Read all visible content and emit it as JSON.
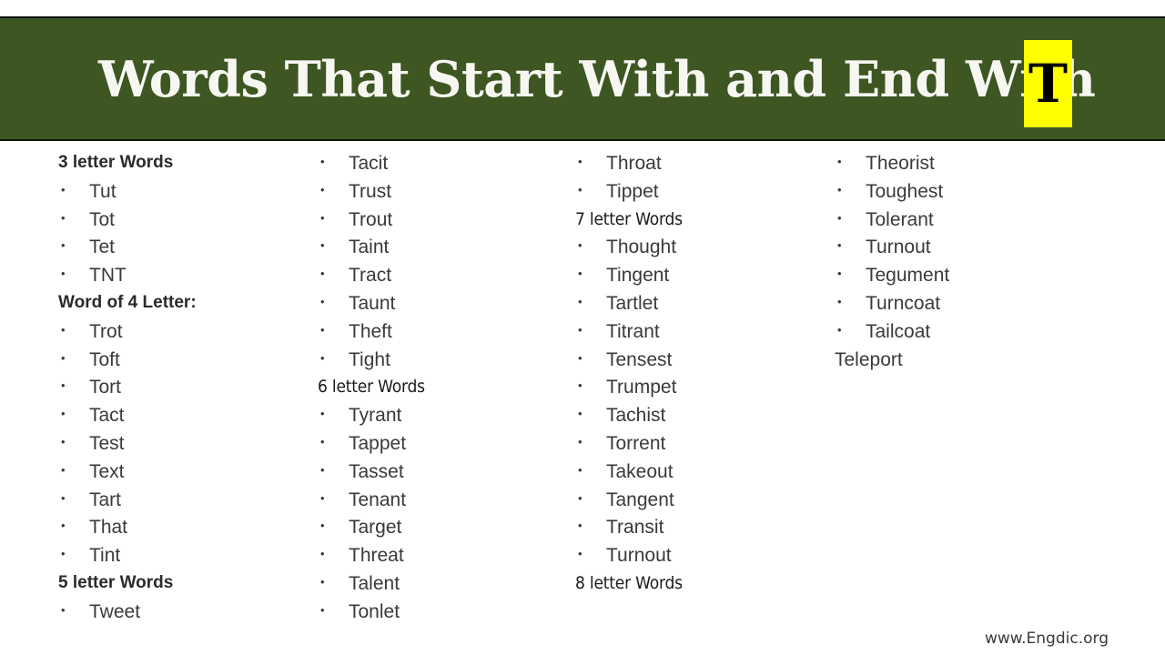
{
  "header": {
    "title": "Words That Start With and End With",
    "letter_badge": "T",
    "background_color": "#3d5622",
    "badge_color": "#ffff00",
    "title_color": "#f7f7f2"
  },
  "columns": [
    {
      "entries": [
        {
          "type": "heading",
          "style": "bold",
          "label": "3 letter Words"
        },
        {
          "type": "word",
          "bullet": "•",
          "label": "Tut"
        },
        {
          "type": "word",
          "bullet": "•",
          "label": "Tot"
        },
        {
          "type": "word",
          "bullet": "•",
          "label": "Tet"
        },
        {
          "type": "word",
          "bullet": "•",
          "label": "TNT"
        },
        {
          "type": "heading",
          "style": "bold",
          "label": "Word of 4 Letter:"
        },
        {
          "type": "word",
          "bullet": "•",
          "label": "Trot"
        },
        {
          "type": "word",
          "bullet": "•",
          "label": "Toft"
        },
        {
          "type": "word",
          "bullet": "•",
          "label": "Tort"
        },
        {
          "type": "word",
          "bullet": "•",
          "label": "Tact"
        },
        {
          "type": "word",
          "bullet": "•",
          "label": "Test"
        },
        {
          "type": "word",
          "bullet": "•",
          "label": "Text"
        },
        {
          "type": "word",
          "bullet": "•",
          "label": "Tart"
        },
        {
          "type": "word",
          "bullet": "•",
          "label": "That"
        },
        {
          "type": "word",
          "bullet": "•",
          "label": "Tint"
        },
        {
          "type": "heading",
          "style": "bold",
          "label": "5 letter Words"
        },
        {
          "type": "word",
          "bullet": "•",
          "label": "Tweet"
        }
      ]
    },
    {
      "entries": [
        {
          "type": "word",
          "bullet": "•",
          "label": "Tacit"
        },
        {
          "type": "word",
          "bullet": "•",
          "label": "Trust"
        },
        {
          "type": "word",
          "bullet": "•",
          "label": "Trout"
        },
        {
          "type": "word",
          "bullet": "•",
          "label": "Taint"
        },
        {
          "type": "word",
          "bullet": "•",
          "label": "Tract"
        },
        {
          "type": "word",
          "bullet": "•",
          "label": "Taunt"
        },
        {
          "type": "word",
          "bullet": "•",
          "label": "Theft"
        },
        {
          "type": "word",
          "bullet": "•",
          "label": "Tight"
        },
        {
          "type": "heading",
          "style": "narrow",
          "label": "6 letter Words"
        },
        {
          "type": "word",
          "bullet": "•",
          "label": "Tyrant"
        },
        {
          "type": "word",
          "bullet": "•",
          "label": "Tappet"
        },
        {
          "type": "word",
          "bullet": "•",
          "label": "Tasset"
        },
        {
          "type": "word",
          "bullet": "•",
          "label": "Tenant"
        },
        {
          "type": "word",
          "bullet": "•",
          "label": "Target"
        },
        {
          "type": "word",
          "bullet": "•",
          "label": "Threat"
        },
        {
          "type": "word",
          "bullet": "•",
          "label": "Talent"
        },
        {
          "type": "word",
          "bullet": "•",
          "label": "Tonlet"
        }
      ]
    },
    {
      "entries": [
        {
          "type": "word",
          "bullet": "•",
          "label": "Throat"
        },
        {
          "type": "word",
          "bullet": "•",
          "label": "Tippet"
        },
        {
          "type": "heading",
          "style": "narrow",
          "label": "7 letter Words"
        },
        {
          "type": "word",
          "bullet": "•",
          "label": "Thought"
        },
        {
          "type": "word",
          "bullet": "•",
          "label": "Tingent"
        },
        {
          "type": "word",
          "bullet": "•",
          "label": "Tartlet"
        },
        {
          "type": "word",
          "bullet": "•",
          "label": "Titrant"
        },
        {
          "type": "word",
          "bullet": "•",
          "label": "Tensest"
        },
        {
          "type": "word",
          "bullet": "•",
          "label": "Trumpet"
        },
        {
          "type": "word",
          "bullet": "•",
          "label": "Tachist"
        },
        {
          "type": "word",
          "bullet": "•",
          "label": "Torrent"
        },
        {
          "type": "word",
          "bullet": "•",
          "label": "Takeout"
        },
        {
          "type": "word",
          "bullet": "•",
          "label": "Tangent"
        },
        {
          "type": "word",
          "bullet": "•",
          "label": "Transit"
        },
        {
          "type": "word",
          "bullet": "•",
          "label": "Turnout"
        },
        {
          "type": "heading",
          "style": "narrow",
          "label": "8 letter Words"
        }
      ]
    },
    {
      "entries": [
        {
          "type": "word",
          "bullet": "•",
          "label": "Theorist"
        },
        {
          "type": "word",
          "bullet": "•",
          "label": "Toughest"
        },
        {
          "type": "word",
          "bullet": "•",
          "label": "Tolerant"
        },
        {
          "type": "word",
          "bullet": "•",
          "label": "Turnout"
        },
        {
          "type": "word",
          "bullet": "•",
          "label": "Tegument"
        },
        {
          "type": "word",
          "bullet": "•",
          "label": "Turncoat"
        },
        {
          "type": "word",
          "bullet": "•",
          "label": "Tailcoat"
        },
        {
          "type": "plain",
          "label": "Teleport"
        }
      ]
    }
  ],
  "footer": {
    "watermark": "www.Engdic.org"
  }
}
